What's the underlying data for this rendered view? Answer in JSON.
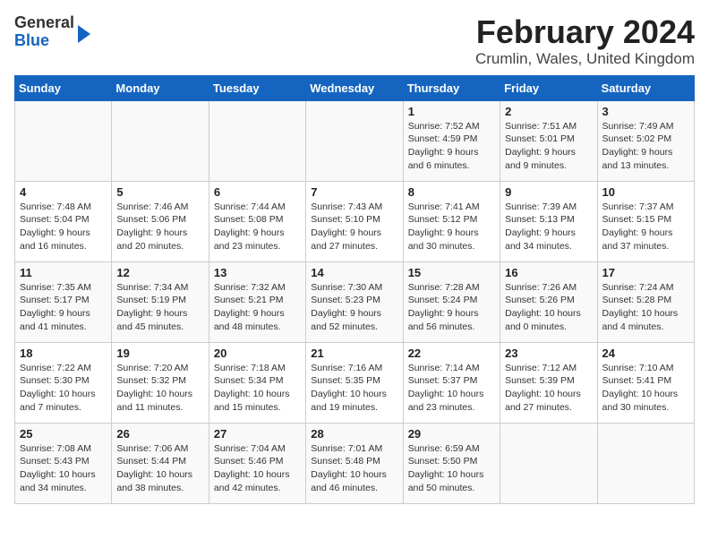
{
  "logo": {
    "general": "General",
    "blue": "Blue"
  },
  "title": "February 2024",
  "subtitle": "Crumlin, Wales, United Kingdom",
  "weekdays": [
    "Sunday",
    "Monday",
    "Tuesday",
    "Wednesday",
    "Thursday",
    "Friday",
    "Saturday"
  ],
  "weeks": [
    [
      {
        "day": "",
        "info": ""
      },
      {
        "day": "",
        "info": ""
      },
      {
        "day": "",
        "info": ""
      },
      {
        "day": "",
        "info": ""
      },
      {
        "day": "1",
        "info": "Sunrise: 7:52 AM\nSunset: 4:59 PM\nDaylight: 9 hours\nand 6 minutes."
      },
      {
        "day": "2",
        "info": "Sunrise: 7:51 AM\nSunset: 5:01 PM\nDaylight: 9 hours\nand 9 minutes."
      },
      {
        "day": "3",
        "info": "Sunrise: 7:49 AM\nSunset: 5:02 PM\nDaylight: 9 hours\nand 13 minutes."
      }
    ],
    [
      {
        "day": "4",
        "info": "Sunrise: 7:48 AM\nSunset: 5:04 PM\nDaylight: 9 hours\nand 16 minutes."
      },
      {
        "day": "5",
        "info": "Sunrise: 7:46 AM\nSunset: 5:06 PM\nDaylight: 9 hours\nand 20 minutes."
      },
      {
        "day": "6",
        "info": "Sunrise: 7:44 AM\nSunset: 5:08 PM\nDaylight: 9 hours\nand 23 minutes."
      },
      {
        "day": "7",
        "info": "Sunrise: 7:43 AM\nSunset: 5:10 PM\nDaylight: 9 hours\nand 27 minutes."
      },
      {
        "day": "8",
        "info": "Sunrise: 7:41 AM\nSunset: 5:12 PM\nDaylight: 9 hours\nand 30 minutes."
      },
      {
        "day": "9",
        "info": "Sunrise: 7:39 AM\nSunset: 5:13 PM\nDaylight: 9 hours\nand 34 minutes."
      },
      {
        "day": "10",
        "info": "Sunrise: 7:37 AM\nSunset: 5:15 PM\nDaylight: 9 hours\nand 37 minutes."
      }
    ],
    [
      {
        "day": "11",
        "info": "Sunrise: 7:35 AM\nSunset: 5:17 PM\nDaylight: 9 hours\nand 41 minutes."
      },
      {
        "day": "12",
        "info": "Sunrise: 7:34 AM\nSunset: 5:19 PM\nDaylight: 9 hours\nand 45 minutes."
      },
      {
        "day": "13",
        "info": "Sunrise: 7:32 AM\nSunset: 5:21 PM\nDaylight: 9 hours\nand 48 minutes."
      },
      {
        "day": "14",
        "info": "Sunrise: 7:30 AM\nSunset: 5:23 PM\nDaylight: 9 hours\nand 52 minutes."
      },
      {
        "day": "15",
        "info": "Sunrise: 7:28 AM\nSunset: 5:24 PM\nDaylight: 9 hours\nand 56 minutes."
      },
      {
        "day": "16",
        "info": "Sunrise: 7:26 AM\nSunset: 5:26 PM\nDaylight: 10 hours\nand 0 minutes."
      },
      {
        "day": "17",
        "info": "Sunrise: 7:24 AM\nSunset: 5:28 PM\nDaylight: 10 hours\nand 4 minutes."
      }
    ],
    [
      {
        "day": "18",
        "info": "Sunrise: 7:22 AM\nSunset: 5:30 PM\nDaylight: 10 hours\nand 7 minutes."
      },
      {
        "day": "19",
        "info": "Sunrise: 7:20 AM\nSunset: 5:32 PM\nDaylight: 10 hours\nand 11 minutes."
      },
      {
        "day": "20",
        "info": "Sunrise: 7:18 AM\nSunset: 5:34 PM\nDaylight: 10 hours\nand 15 minutes."
      },
      {
        "day": "21",
        "info": "Sunrise: 7:16 AM\nSunset: 5:35 PM\nDaylight: 10 hours\nand 19 minutes."
      },
      {
        "day": "22",
        "info": "Sunrise: 7:14 AM\nSunset: 5:37 PM\nDaylight: 10 hours\nand 23 minutes."
      },
      {
        "day": "23",
        "info": "Sunrise: 7:12 AM\nSunset: 5:39 PM\nDaylight: 10 hours\nand 27 minutes."
      },
      {
        "day": "24",
        "info": "Sunrise: 7:10 AM\nSunset: 5:41 PM\nDaylight: 10 hours\nand 30 minutes."
      }
    ],
    [
      {
        "day": "25",
        "info": "Sunrise: 7:08 AM\nSunset: 5:43 PM\nDaylight: 10 hours\nand 34 minutes."
      },
      {
        "day": "26",
        "info": "Sunrise: 7:06 AM\nSunset: 5:44 PM\nDaylight: 10 hours\nand 38 minutes."
      },
      {
        "day": "27",
        "info": "Sunrise: 7:04 AM\nSunset: 5:46 PM\nDaylight: 10 hours\nand 42 minutes."
      },
      {
        "day": "28",
        "info": "Sunrise: 7:01 AM\nSunset: 5:48 PM\nDaylight: 10 hours\nand 46 minutes."
      },
      {
        "day": "29",
        "info": "Sunrise: 6:59 AM\nSunset: 5:50 PM\nDaylight: 10 hours\nand 50 minutes."
      },
      {
        "day": "",
        "info": ""
      },
      {
        "day": "",
        "info": ""
      }
    ]
  ]
}
